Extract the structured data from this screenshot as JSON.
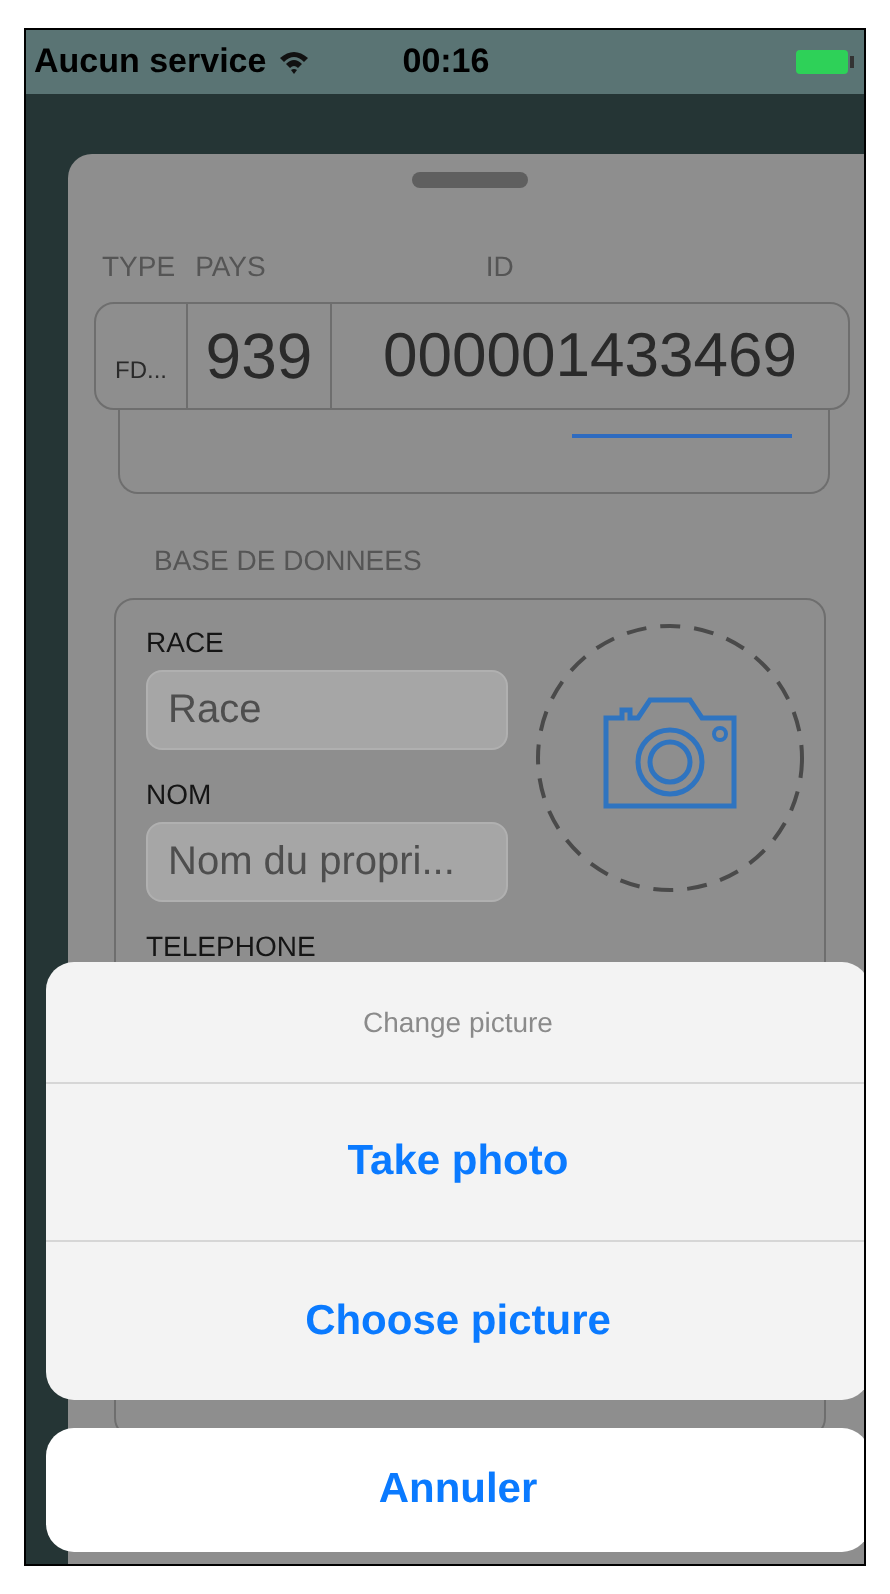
{
  "status_bar": {
    "carrier": "Aucun service",
    "time": "00:16"
  },
  "id_form": {
    "labels": [
      "TYPE",
      "PAYS",
      "ID"
    ],
    "values": [
      "FD...",
      "939",
      "000001433469"
    ]
  },
  "database": {
    "section_title": "BASE DE DONNEES",
    "fields": [
      {
        "label": "RACE",
        "placeholder": "Race"
      },
      {
        "label": "NOM",
        "placeholder": "Nom du propri..."
      },
      {
        "label": "TELEPHONE"
      }
    ]
  },
  "action_sheet": {
    "title": "Change picture",
    "actions": [
      "Take photo",
      "Choose picture"
    ],
    "cancel": "Annuler"
  }
}
